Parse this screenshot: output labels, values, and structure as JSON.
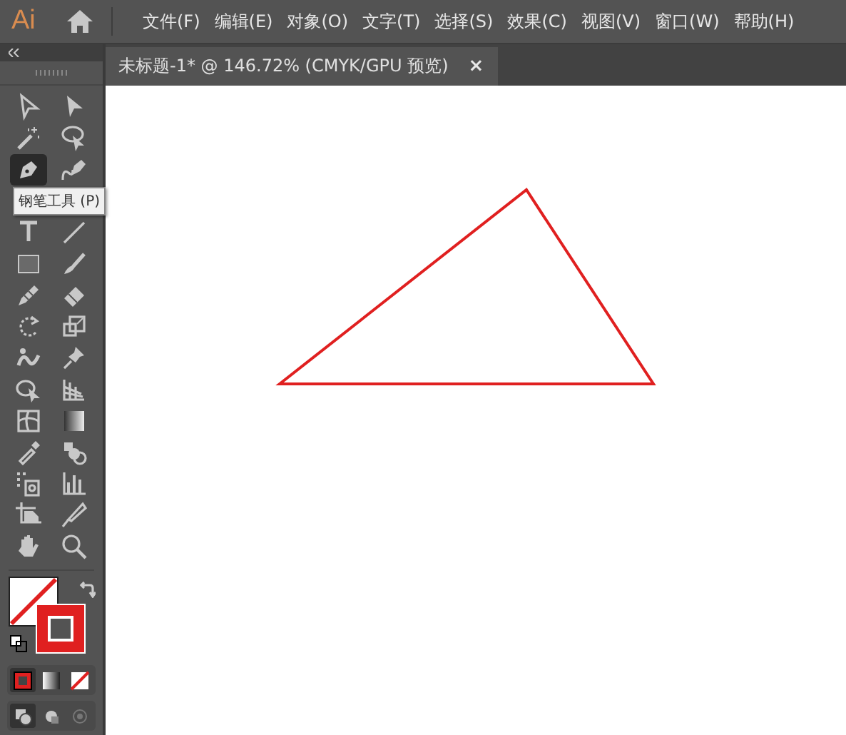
{
  "app": {
    "logo": "Ai"
  },
  "menu": [
    "文件(F)",
    "编辑(E)",
    "对象(O)",
    "文字(T)",
    "选择(S)",
    "效果(C)",
    "视图(V)",
    "窗口(W)",
    "帮助(H)"
  ],
  "document_tab": {
    "title": "未标题-1* @ 146.72% (CMYK/GPU 预览)",
    "close": "×"
  },
  "tools": [
    {
      "kind": "select",
      "selected": false
    },
    {
      "kind": "direct",
      "selected": false
    },
    {
      "kind": "wand",
      "selected": false
    },
    {
      "kind": "lasso",
      "selected": false
    },
    {
      "kind": "pen",
      "selected": true
    },
    {
      "kind": "curvature",
      "selected": false
    },
    {
      "kind": "type",
      "selected": false
    },
    {
      "kind": "line",
      "selected": false
    },
    {
      "kind": "rect",
      "selected": false
    },
    {
      "kind": "brush",
      "selected": false
    },
    {
      "kind": "pencil",
      "selected": false
    },
    {
      "kind": "eraser",
      "selected": false
    },
    {
      "kind": "rotate",
      "selected": false
    },
    {
      "kind": "scale",
      "selected": false
    },
    {
      "kind": "warp",
      "selected": false
    },
    {
      "kind": "pin",
      "selected": false
    },
    {
      "kind": "transform",
      "selected": false
    },
    {
      "kind": "perspective",
      "selected": false
    },
    {
      "kind": "mesh",
      "selected": false
    },
    {
      "kind": "gradient",
      "selected": false
    },
    {
      "kind": "eyedropper",
      "selected": false
    },
    {
      "kind": "blend",
      "selected": false
    },
    {
      "kind": "sprayer",
      "selected": false
    },
    {
      "kind": "graph",
      "selected": false
    },
    {
      "kind": "artboard",
      "selected": false
    },
    {
      "kind": "knife",
      "selected": false
    },
    {
      "kind": "hand",
      "selected": false
    },
    {
      "kind": "zoom",
      "selected": false
    }
  ],
  "tooltip": "钢笔工具 (P)",
  "color_modes": [
    {
      "kind": "color",
      "selected": true
    },
    {
      "kind": "gradient",
      "selected": false
    },
    {
      "kind": "none",
      "selected": false
    }
  ],
  "draw_modes": [
    {
      "kind": "normal",
      "selected": true
    },
    {
      "kind": "behind",
      "selected": false
    },
    {
      "kind": "inside",
      "selected": false
    }
  ]
}
